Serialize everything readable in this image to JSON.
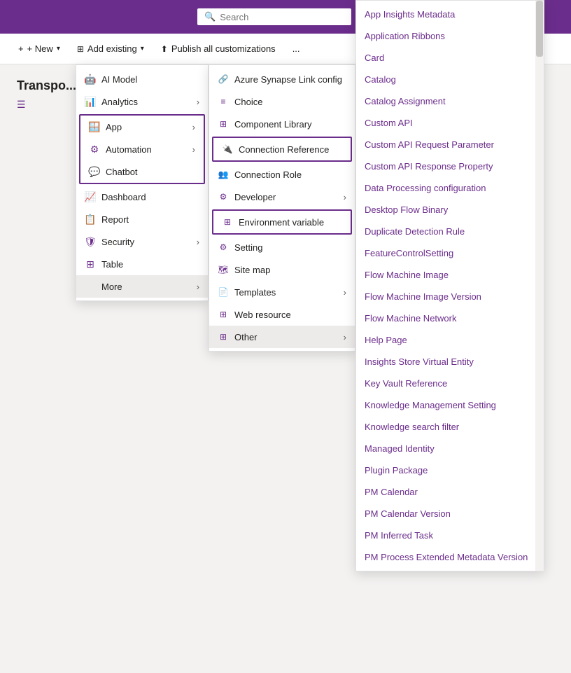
{
  "topbar": {
    "search_placeholder": "Search"
  },
  "toolbar": {
    "new_label": "+ New",
    "add_existing_label": "Add existing",
    "publish_label": "Publish all customizations",
    "more_label": "..."
  },
  "page": {
    "title": "Transpo..."
  },
  "menu_l1": {
    "items": [
      {
        "id": "ai-model",
        "label": "AI Model",
        "icon": "🤖",
        "has_sub": false
      },
      {
        "id": "analytics",
        "label": "Analytics",
        "icon": "📊",
        "has_sub": true
      },
      {
        "id": "app",
        "label": "App",
        "icon": "🪟",
        "has_sub": true,
        "boxed": true
      },
      {
        "id": "automation",
        "label": "Automation",
        "icon": "⚙",
        "has_sub": true,
        "boxed": true
      },
      {
        "id": "chatbot",
        "label": "Chatbot",
        "icon": "💬",
        "has_sub": false,
        "boxed": true
      },
      {
        "id": "dashboard",
        "label": "Dashboard",
        "icon": "📈",
        "has_sub": false
      },
      {
        "id": "report",
        "label": "Report",
        "icon": "📋",
        "has_sub": false
      },
      {
        "id": "security",
        "label": "Security",
        "icon": "🛡",
        "has_sub": true
      },
      {
        "id": "table",
        "label": "Table",
        "icon": "⊞",
        "has_sub": false
      },
      {
        "id": "more",
        "label": "More",
        "icon": "",
        "has_sub": true,
        "active": true
      }
    ]
  },
  "menu_l2": {
    "items": [
      {
        "id": "azure",
        "label": "Azure Synapse Link config",
        "icon": "🔗",
        "has_sub": false
      },
      {
        "id": "choice",
        "label": "Choice",
        "icon": "≡",
        "has_sub": false
      },
      {
        "id": "component-library",
        "label": "Component Library",
        "icon": "⊞",
        "has_sub": false
      },
      {
        "id": "connection-reference",
        "label": "Connection Reference",
        "icon": "🔌",
        "has_sub": false,
        "boxed": true
      },
      {
        "id": "connection-role",
        "label": "Connection Role",
        "icon": "👥",
        "has_sub": false
      },
      {
        "id": "developer",
        "label": "Developer",
        "icon": "⚙",
        "has_sub": true
      },
      {
        "id": "environment-variable",
        "label": "Environment variable",
        "icon": "⊞",
        "has_sub": false,
        "boxed": true
      },
      {
        "id": "setting",
        "label": "Setting",
        "icon": "⚙",
        "has_sub": false
      },
      {
        "id": "site-map",
        "label": "Site map",
        "icon": "🗺",
        "has_sub": false
      },
      {
        "id": "templates",
        "label": "Templates",
        "icon": "📄",
        "has_sub": true
      },
      {
        "id": "web-resource",
        "label": "Web resource",
        "icon": "⊞",
        "has_sub": false
      },
      {
        "id": "other",
        "label": "Other",
        "icon": "⊞",
        "has_sub": true
      }
    ]
  },
  "menu_l3": {
    "items": [
      {
        "id": "app-insights",
        "label": "App Insights Metadata"
      },
      {
        "id": "app-ribbons",
        "label": "Application Ribbons"
      },
      {
        "id": "card",
        "label": "Card"
      },
      {
        "id": "catalog",
        "label": "Catalog"
      },
      {
        "id": "catalog-assignment",
        "label": "Catalog Assignment"
      },
      {
        "id": "custom-api",
        "label": "Custom API"
      },
      {
        "id": "custom-api-request",
        "label": "Custom API Request Parameter"
      },
      {
        "id": "custom-api-response",
        "label": "Custom API Response Property"
      },
      {
        "id": "data-processing",
        "label": "Data Processing configuration"
      },
      {
        "id": "desktop-flow",
        "label": "Desktop Flow Binary"
      },
      {
        "id": "duplicate-detection",
        "label": "Duplicate Detection Rule"
      },
      {
        "id": "feature-control",
        "label": "FeatureControlSetting"
      },
      {
        "id": "flow-machine-image",
        "label": "Flow Machine Image"
      },
      {
        "id": "flow-machine-image-version",
        "label": "Flow Machine Image Version"
      },
      {
        "id": "flow-machine-network",
        "label": "Flow Machine Network"
      },
      {
        "id": "help-page",
        "label": "Help Page"
      },
      {
        "id": "insights-store",
        "label": "Insights Store Virtual Entity"
      },
      {
        "id": "key-vault",
        "label": "Key Vault Reference"
      },
      {
        "id": "knowledge-management",
        "label": "Knowledge Management Setting"
      },
      {
        "id": "knowledge-search",
        "label": "Knowledge search filter"
      },
      {
        "id": "managed-identity",
        "label": "Managed Identity"
      },
      {
        "id": "plugin-package",
        "label": "Plugin Package"
      },
      {
        "id": "pm-calendar",
        "label": "PM Calendar"
      },
      {
        "id": "pm-calendar-version",
        "label": "PM Calendar Version"
      },
      {
        "id": "pm-inferred-task",
        "label": "PM Inferred Task"
      },
      {
        "id": "pm-process-extended",
        "label": "PM Process Extended Metadata Version"
      }
    ]
  }
}
